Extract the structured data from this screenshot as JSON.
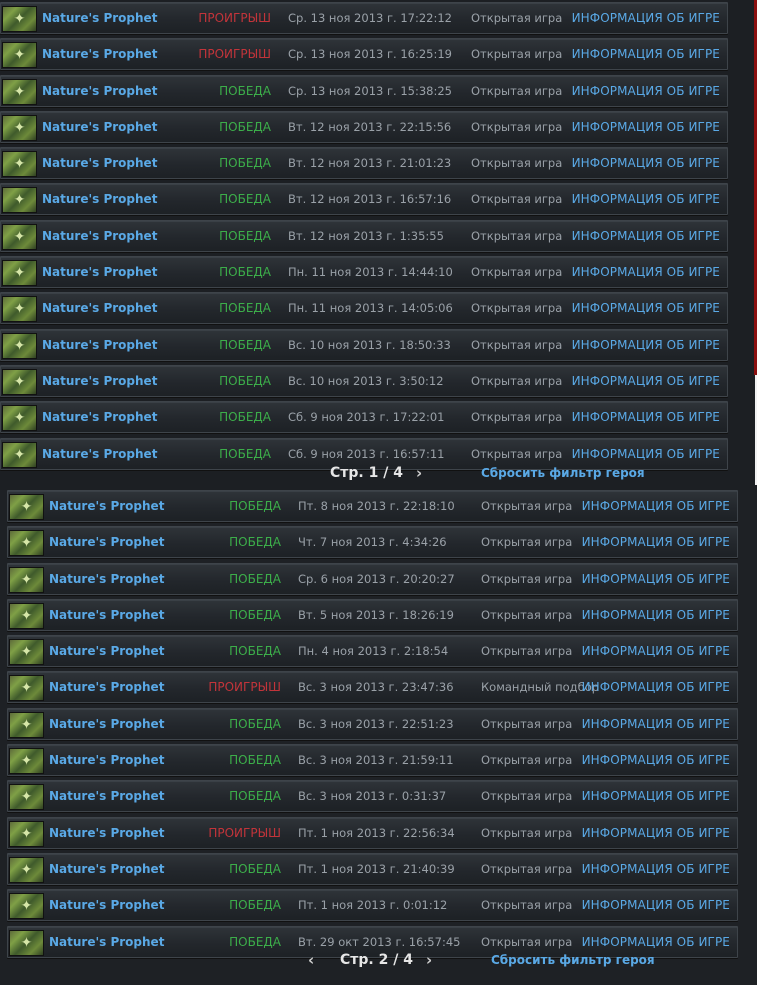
{
  "page1": {
    "rows": [
      {
        "hero": "Nature's Prophet",
        "result": "ПРОИГРЫШ",
        "status": "loss",
        "date": "Ср. 13 ноя 2013 г. 17:22:12",
        "mode": "Открытая игра",
        "info": "ИНФОРМАЦИЯ ОБ ИГРЕ"
      },
      {
        "hero": "Nature's Prophet",
        "result": "ПРОИГРЫШ",
        "status": "loss",
        "date": "Ср. 13 ноя 2013 г. 16:25:19",
        "mode": "Открытая игра",
        "info": "ИНФОРМАЦИЯ ОБ ИГРЕ"
      },
      {
        "hero": "Nature's Prophet",
        "result": "ПОБЕДА",
        "status": "win",
        "date": "Ср. 13 ноя 2013 г. 15:38:25",
        "mode": "Открытая игра",
        "info": "ИНФОРМАЦИЯ ОБ ИГРЕ"
      },
      {
        "hero": "Nature's Prophet",
        "result": "ПОБЕДА",
        "status": "win",
        "date": "Вт. 12 ноя 2013 г. 22:15:56",
        "mode": "Открытая игра",
        "info": "ИНФОРМАЦИЯ ОБ ИГРЕ"
      },
      {
        "hero": "Nature's Prophet",
        "result": "ПОБЕДА",
        "status": "win",
        "date": "Вт. 12 ноя 2013 г. 21:01:23",
        "mode": "Открытая игра",
        "info": "ИНФОРМАЦИЯ ОБ ИГРЕ"
      },
      {
        "hero": "Nature's Prophet",
        "result": "ПОБЕДА",
        "status": "win",
        "date": "Вт. 12 ноя 2013 г. 16:57:16",
        "mode": "Открытая игра",
        "info": "ИНФОРМАЦИЯ ОБ ИГРЕ"
      },
      {
        "hero": "Nature's Prophet",
        "result": "ПОБЕДА",
        "status": "win",
        "date": "Вт. 12 ноя 2013 г. 1:35:55",
        "mode": "Открытая игра",
        "info": "ИНФОРМАЦИЯ ОБ ИГРЕ"
      },
      {
        "hero": "Nature's Prophet",
        "result": "ПОБЕДА",
        "status": "win",
        "date": "Пн. 11 ноя 2013 г. 14:44:10",
        "mode": "Открытая игра",
        "info": "ИНФОРМАЦИЯ ОБ ИГРЕ"
      },
      {
        "hero": "Nature's Prophet",
        "result": "ПОБЕДА",
        "status": "win",
        "date": "Пн. 11 ноя 2013 г. 14:05:06",
        "mode": "Открытая игра",
        "info": "ИНФОРМАЦИЯ ОБ ИГРЕ"
      },
      {
        "hero": "Nature's Prophet",
        "result": "ПОБЕДА",
        "status": "win",
        "date": "Вс. 10 ноя 2013 г. 18:50:33",
        "mode": "Открытая игра",
        "info": "ИНФОРМАЦИЯ ОБ ИГРЕ"
      },
      {
        "hero": "Nature's Prophet",
        "result": "ПОБЕДА",
        "status": "win",
        "date": "Вс. 10 ноя 2013 г. 3:50:12",
        "mode": "Открытая игра",
        "info": "ИНФОРМАЦИЯ ОБ ИГРЕ"
      },
      {
        "hero": "Nature's Prophet",
        "result": "ПОБЕДА",
        "status": "win",
        "date": "Сб. 9 ноя 2013 г. 17:22:01",
        "mode": "Открытая игра",
        "info": "ИНФОРМАЦИЯ ОБ ИГРЕ"
      },
      {
        "hero": "Nature's Prophet",
        "result": "ПОБЕДА",
        "status": "win",
        "date": "Сб. 9 ноя 2013 г. 16:57:11",
        "mode": "Открытая игра",
        "info": "ИНФОРМАЦИЯ ОБ ИГРЕ"
      }
    ],
    "pager": {
      "label": "Стр. 1 / 4",
      "next": "›"
    },
    "reset": "Сбросить фильтр героя"
  },
  "page2": {
    "rows": [
      {
        "hero": "Nature's Prophet",
        "result": "ПОБЕДА",
        "status": "win",
        "date": "Пт. 8 ноя 2013 г. 22:18:10",
        "mode": "Открытая игра",
        "info": "ИНФОРМАЦИЯ ОБ ИГРЕ"
      },
      {
        "hero": "Nature's Prophet",
        "result": "ПОБЕДА",
        "status": "win",
        "date": "Чт. 7 ноя 2013 г. 4:34:26",
        "mode": "Открытая игра",
        "info": "ИНФОРМАЦИЯ ОБ ИГРЕ"
      },
      {
        "hero": "Nature's Prophet",
        "result": "ПОБЕДА",
        "status": "win",
        "date": "Ср. 6 ноя 2013 г. 20:20:27",
        "mode": "Открытая игра",
        "info": "ИНФОРМАЦИЯ ОБ ИГРЕ"
      },
      {
        "hero": "Nature's Prophet",
        "result": "ПОБЕДА",
        "status": "win",
        "date": "Вт. 5 ноя 2013 г. 18:26:19",
        "mode": "Открытая игра",
        "info": "ИНФОРМАЦИЯ ОБ ИГРЕ"
      },
      {
        "hero": "Nature's Prophet",
        "result": "ПОБЕДА",
        "status": "win",
        "date": "Пн. 4 ноя 2013 г. 2:18:54",
        "mode": "Открытая игра",
        "info": "ИНФОРМАЦИЯ ОБ ИГРЕ"
      },
      {
        "hero": "Nature's Prophet",
        "result": "ПРОИГРЫШ",
        "status": "loss",
        "date": "Вс. 3 ноя 2013 г. 23:47:36",
        "mode": "Командный подбор",
        "info": "ИНФОРМАЦИЯ ОБ ИГРЕ"
      },
      {
        "hero": "Nature's Prophet",
        "result": "ПОБЕДА",
        "status": "win",
        "date": "Вс. 3 ноя 2013 г. 22:51:23",
        "mode": "Открытая игра",
        "info": "ИНФОРМАЦИЯ ОБ ИГРЕ"
      },
      {
        "hero": "Nature's Prophet",
        "result": "ПОБЕДА",
        "status": "win",
        "date": "Вс. 3 ноя 2013 г. 21:59:11",
        "mode": "Открытая игра",
        "info": "ИНФОРМАЦИЯ ОБ ИГРЕ"
      },
      {
        "hero": "Nature's Prophet",
        "result": "ПОБЕДА",
        "status": "win",
        "date": "Вс. 3 ноя 2013 г. 0:31:37",
        "mode": "Открытая игра",
        "info": "ИНФОРМАЦИЯ ОБ ИГРЕ"
      },
      {
        "hero": "Nature's Prophet",
        "result": "ПРОИГРЫШ",
        "status": "loss",
        "date": "Пт. 1 ноя 2013 г. 22:56:34",
        "mode": "Открытая игра",
        "info": "ИНФОРМАЦИЯ ОБ ИГРЕ"
      },
      {
        "hero": "Nature's Prophet",
        "result": "ПОБЕДА",
        "status": "win",
        "date": "Пт. 1 ноя 2013 г. 21:40:39",
        "mode": "Открытая игра",
        "info": "ИНФОРМАЦИЯ ОБ ИГРЕ"
      },
      {
        "hero": "Nature's Prophet",
        "result": "ПОБЕДА",
        "status": "win",
        "date": "Пт. 1 ноя 2013 г. 0:01:12",
        "mode": "Открытая игра",
        "info": "ИНФОРМАЦИЯ ОБ ИГРЕ"
      },
      {
        "hero": "Nature's Prophet",
        "result": "ПОБЕДА",
        "status": "win",
        "date": "Вт. 29 окт 2013 г. 16:57:45",
        "mode": "Открытая игра",
        "info": "ИНФОРМАЦИЯ ОБ ИГРЕ"
      }
    ],
    "pager": {
      "label": "Стр. 2 / 4",
      "prev": "‹",
      "next": "›"
    },
    "reset": "Сбросить фильтр героя"
  },
  "colors": {
    "win": "#3cae4a",
    "loss": "#c2343a",
    "link": "#5aa9e6"
  },
  "icons": {
    "portrait": "hero-portrait-icon"
  }
}
